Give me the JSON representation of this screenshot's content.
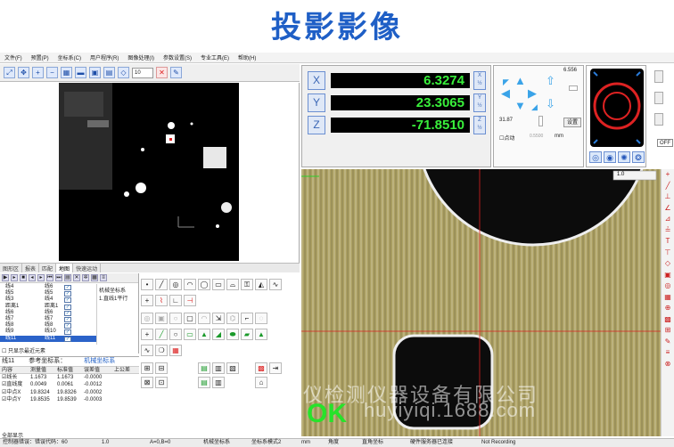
{
  "banner": {
    "title": "投影影像"
  },
  "menu": [
    "文件(F)",
    "预置(P)",
    "坐标系(C)",
    "用户程序(R)",
    "图像处理(I)",
    "参数设置(S)",
    "专业工具(E)",
    "帮助(H)"
  ],
  "toolbar": {
    "zoom": "10"
  },
  "tabs": [
    "图形区",
    "报表",
    "匹配",
    "地图",
    "快速运动"
  ],
  "elements": [
    {
      "name": "线4",
      "layer": "线6",
      "checked": "✓"
    },
    {
      "name": "线5",
      "layer": "线5",
      "checked": "✓"
    },
    {
      "name": "线3",
      "layer": "线4",
      "checked": "✓"
    },
    {
      "name": "距离1",
      "layer": "距离1",
      "checked": "✓"
    },
    {
      "name": "线6",
      "layer": "线6",
      "checked": "✓"
    },
    {
      "name": "线7",
      "layer": "线7",
      "checked": "✓"
    },
    {
      "name": "线8",
      "layer": "线8",
      "checked": "✓"
    },
    {
      "name": "线9",
      "layer": "线10",
      "checked": "✓"
    },
    {
      "name": "线11",
      "layer": "线11",
      "checked": "✓"
    }
  ],
  "mini": {
    "title": "机械坐标系",
    "item": "1.直线1平行"
  },
  "only_show": "只显示最近元素",
  "coords": {
    "title": "线11",
    "ref_label": "参考坐标系：",
    "ref_value": "机械坐标系",
    "headers": [
      "内容",
      "测量值",
      "标准值",
      "误差值",
      "上公差"
    ],
    "rows": [
      {
        "c": "线长",
        "m": "1.1673",
        "s": "1.1673",
        "e": "-0.0000"
      },
      {
        "c": "直线度",
        "m": "0.0049",
        "s": "0.0061",
        "e": "-0.0012"
      },
      {
        "c": "中点X",
        "m": "19.8324",
        "s": "19.8326",
        "e": "-0.0002"
      },
      {
        "c": "中点Y",
        "m": "19.8535",
        "s": "19.8539",
        "e": "-0.0003"
      }
    ]
  },
  "all_show": "全部显示",
  "dro": {
    "axes": [
      {
        "label": "X",
        "value": "6.3274"
      },
      {
        "label": "Y",
        "value": "23.3065"
      },
      {
        "label": "Z",
        "value": "-71.8510"
      }
    ]
  },
  "motion": {
    "val_top": "6.556",
    "val_left": "31.87",
    "val_bottom": "0.5500",
    "unit": "mm",
    "jog": "点动",
    "setup": "设置"
  },
  "ring": {
    "off": "OFF"
  },
  "camera": {
    "dropdown": "1.0",
    "ok": "OK",
    "watermark": "广东厚仪检测仪器设备有限公司",
    "url": "huyiyiqi.1688.com"
  },
  "status": [
    "控制器错误：错误代码：60",
    "1.0",
    "A=0,B=0",
    "机械坐标系",
    "坐标系模式2",
    "mm",
    "角度",
    "直角坐标",
    "硬件服务器已连接",
    "Not Recording"
  ]
}
